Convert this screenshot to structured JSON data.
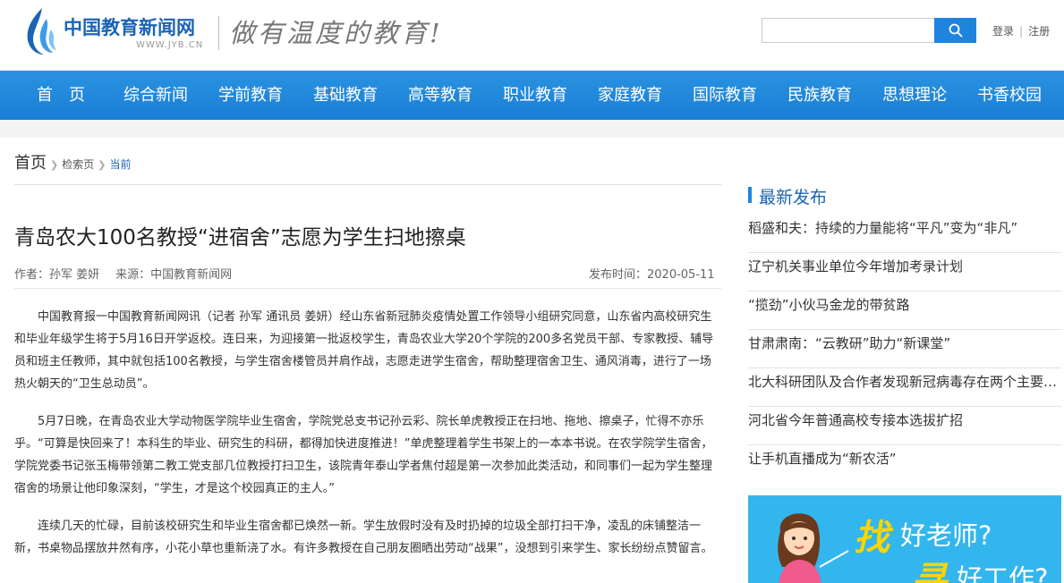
{
  "header": {
    "logo_name": "中国教育新闻网",
    "logo_url": "WWW.JYB.CN",
    "slogan": "做有温度的教育!",
    "search_placeholder": "",
    "login": "登录",
    "register": "注册",
    "auth_separator": "|",
    "search_icon": "search-icon"
  },
  "nav": {
    "items": [
      "首　页",
      "综合新闻",
      "学前教育",
      "基础教育",
      "高等教育",
      "职业教育",
      "家庭教育",
      "国际教育",
      "民族教育",
      "思想理论",
      "书香校园"
    ]
  },
  "breadcrumb": {
    "home": "首页",
    "search": "检索页",
    "current": "当前"
  },
  "article": {
    "title": "青岛农大100名教授“进宿舍”志愿为学生扫地擦桌",
    "author": "作者：孙军 姜妍",
    "source": "来源：中国教育新闻网",
    "publish_time": "发布时间：2020-05-11",
    "paragraphs": [
      "中国教育报一中国教育新闻网讯（记者 孙军 通讯员 姜妍）经山东省新冠肺炎疫情处置工作领导小组研究同意，山东省内高校研究生和毕业年级学生将于5月16日开学返校。连日来，为迎接第一批返校学生，青岛农业大学20个学院的200多名党员干部、专家教授、辅导员和班主任教师，其中就包括100名教授，与学生宿舍楼管员并肩作战，志愿走进学生宿舍，帮助整理宿舍卫生、通风消毒，进行了一场热火朝天的“卫生总动员”。",
      "5月7日晚，在青岛农业大学动物医学院毕业生宿舍，学院党总支书记孙云彩、院长单虎教授正在扫地、拖地、擦桌子，忙得不亦乐乎。“可算是快回来了！本科生的毕业、研究生的科研，都得加快进度推进！”单虎整理着学生书架上的一本本书说。在农学院学生宿舍，学院党委书记张玉梅带领第二教工党支部几位教授打扫卫生，该院青年泰山学者焦付超是第一次参加此类活动，和同事们一起为学生整理宿舍的场景让他印象深刻，“学生，才是这个校园真正的主人。”",
      "连续几天的忙碌，目前该校研究生和毕业生宿舍都已焕然一新。学生放假时没有及时扔掉的垃圾全部打扫干净，凌乱的床铺整洁一新，书桌物品摆放井然有序，小花小草也重新浇了水。有许多教授在自己朋友圈晒出劳动“战果”，没想到引来学生、家长纷纷点赞留言。"
    ]
  },
  "sidebar": {
    "title": "最新发布",
    "items": [
      "稻盛和夫：持续的力量能将“平凡”变为“非凡”",
      "辽宁机关事业单位今年增加考录计划",
      "“揽劲”小伙马金龙的带贫路",
      "甘肃肃南：“云教研”助力“新课堂”",
      "北大科研团队及合作者发现新冠病毒存在两个主要亚型",
      "河北省今年普通高校专接本选拔扩招",
      "让手机直播成为“新农活”"
    ]
  },
  "ad": {
    "zhao": "找",
    "line1": "好老师?",
    "xun": "寻",
    "line2": "好工作?"
  },
  "colors": {
    "brand_blue": "#1c64b4",
    "nav_blue": "#1e84de",
    "ad_bg": "#33b6ee",
    "ad_highlight": "#ffd400"
  }
}
